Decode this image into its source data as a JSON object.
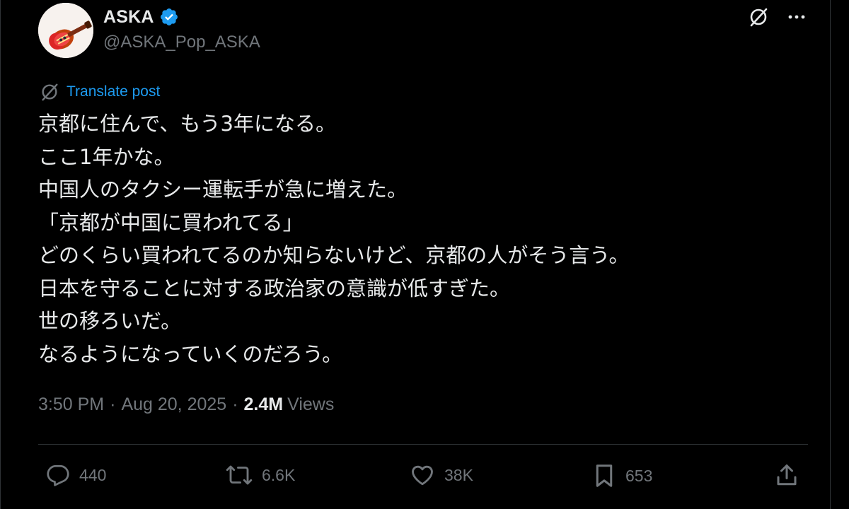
{
  "author": {
    "display_name": "ASKA",
    "handle": "@ASKA_Pop_ASKA",
    "verified": true
  },
  "translate_label": "Translate post",
  "post_lines": [
    "京都に住んで、もう3年になる。",
    "ここ1年かな。",
    "中国人のタクシー運転手が急に増えた。",
    "「京都が中国に買われてる」",
    "どのくらい買われてるのか知らないけど、京都の人がそう言う。",
    "日本を守ることに対する政治家の意識が低すぎた。",
    "世の移ろいだ。",
    "なるようになっていくのだろう。"
  ],
  "meta": {
    "time": "3:50 PM",
    "date": "Aug 20, 2025",
    "views_count": "2.4M",
    "views_label": "Views"
  },
  "actions": {
    "replies": "440",
    "reposts": "6.6K",
    "likes": "38K",
    "bookmarks": "653"
  },
  "colors": {
    "background": "#000000",
    "text": "#e7e9ea",
    "muted": "#71767b",
    "accent": "#1d9bf0",
    "border": "#2f3336"
  },
  "icons": [
    "grok-icon",
    "more-icon",
    "translate-icon",
    "reply-icon",
    "repost-icon",
    "like-icon",
    "bookmark-icon",
    "share-icon",
    "verified-badge-icon"
  ]
}
